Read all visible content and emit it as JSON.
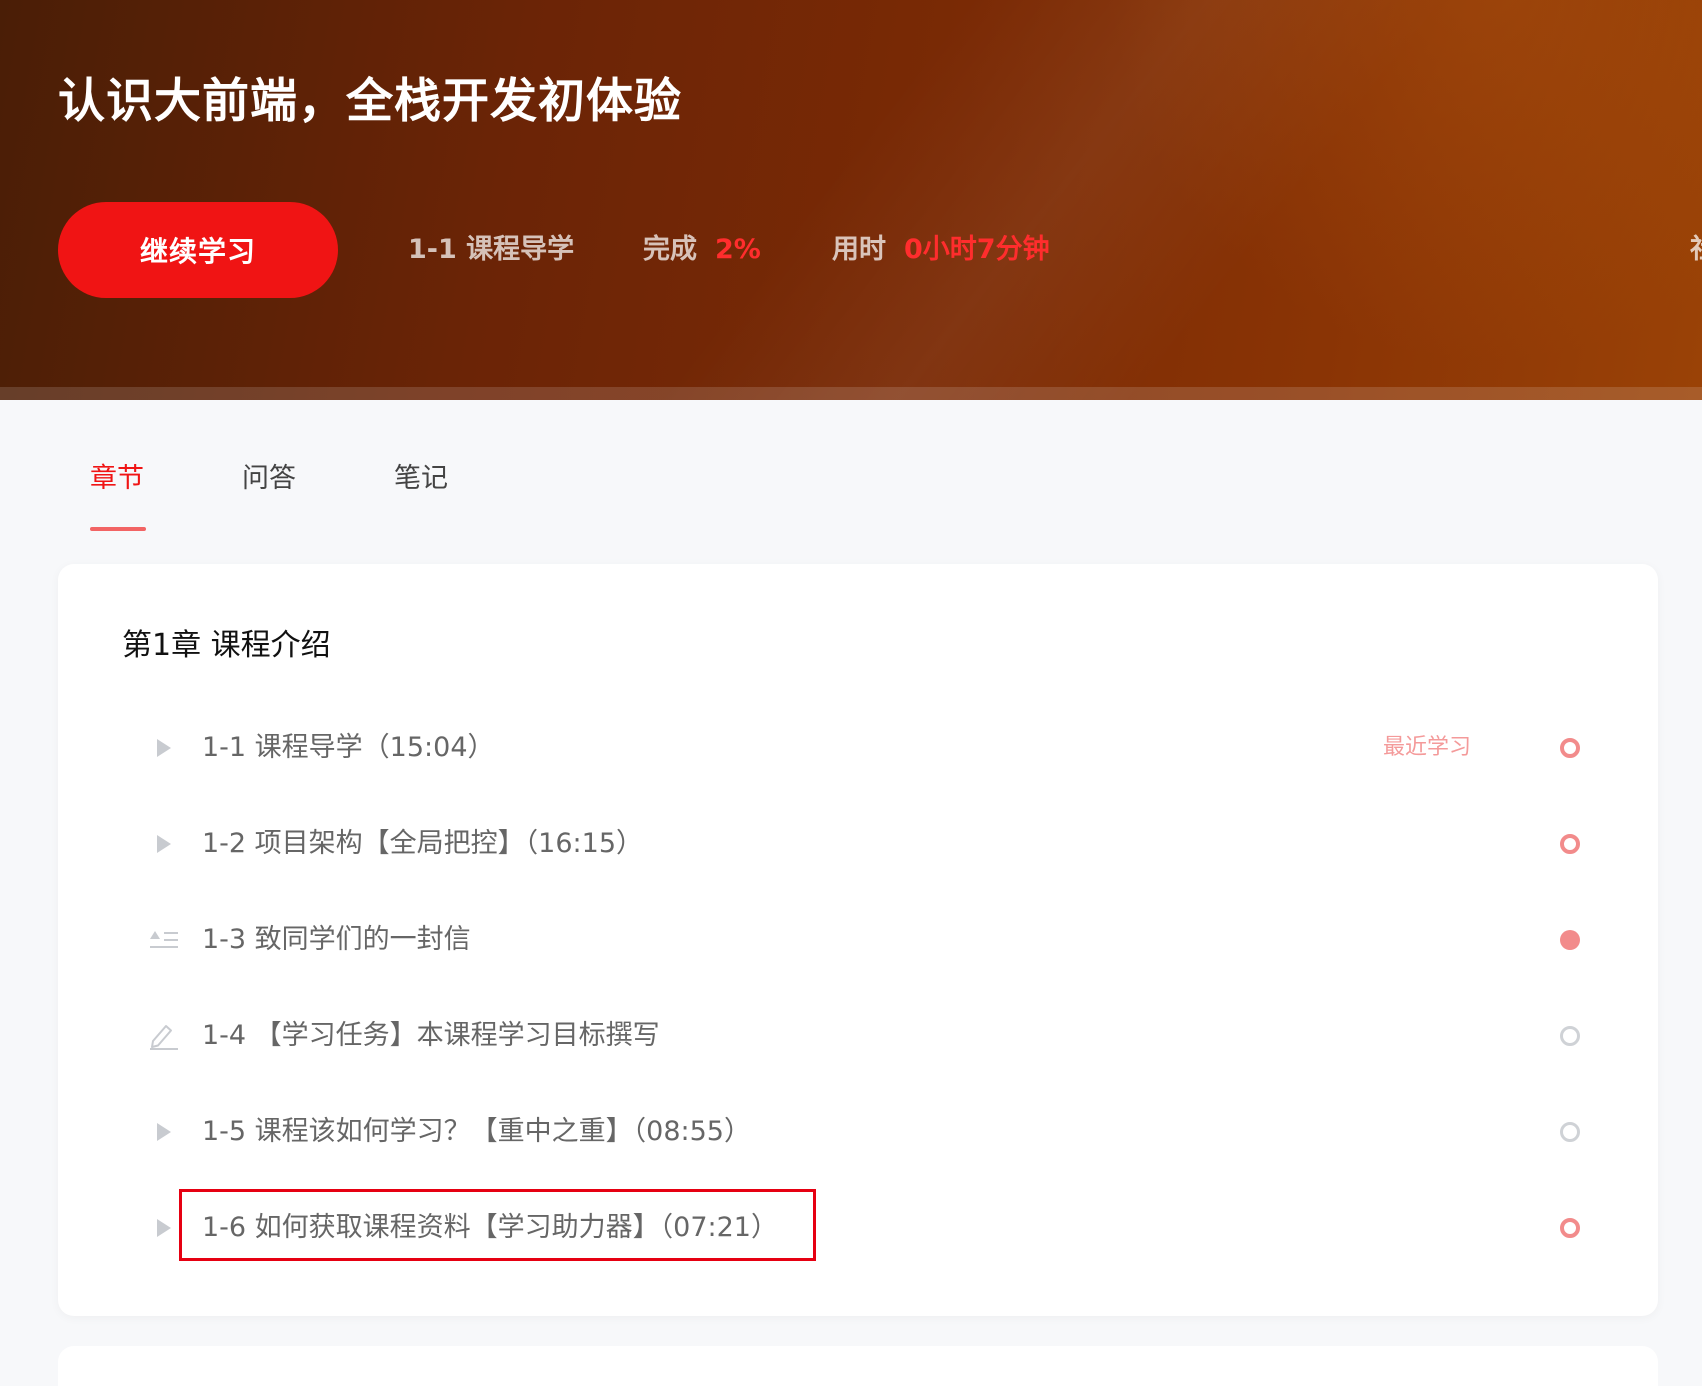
{
  "course": {
    "title": "认识大前端，全栈开发初体验",
    "continue_label": "继续学习",
    "current_lesson": "1-1 课程导学",
    "progress_label": "完成",
    "progress_value": "2%",
    "time_label": "用时",
    "time_value": "0小时7分钟",
    "edge_glyph": "社"
  },
  "tabs": [
    {
      "label": "章节",
      "active": true
    },
    {
      "label": "问答",
      "active": false
    },
    {
      "label": "笔记",
      "active": false
    }
  ],
  "chapter": {
    "title": "第1章 课程介绍",
    "lessons": [
      {
        "text": "1-1 课程导学（15:04）",
        "type": "video",
        "icon": "play-icon",
        "recent_tag": "最近学习",
        "status": "in-progress"
      },
      {
        "text": "1-2 项目架构【全局把控】（16:15）",
        "type": "video",
        "icon": "play-icon",
        "status": "in-progress"
      },
      {
        "text": "1-3 致同学们的一封信",
        "type": "article",
        "icon": "article-icon",
        "status": "completed"
      },
      {
        "text": "1-4 【学习任务】本课程学习目标撰写",
        "type": "task",
        "icon": "edit-icon",
        "status": "not-started"
      },
      {
        "text": "1-5 课程该如何学习？【重中之重】（08:55）",
        "type": "video",
        "icon": "play-icon",
        "status": "not-started"
      },
      {
        "text": "1-6 如何获取课程资料【学习助力器】（07:21）",
        "type": "video",
        "icon": "play-icon",
        "status": "in-progress",
        "highlighted": true
      }
    ]
  },
  "colors": {
    "accent": "#f01414",
    "status_red": "#f28b8b",
    "status_grey": "#cfd2d6",
    "highlight_border": "#e60012"
  }
}
